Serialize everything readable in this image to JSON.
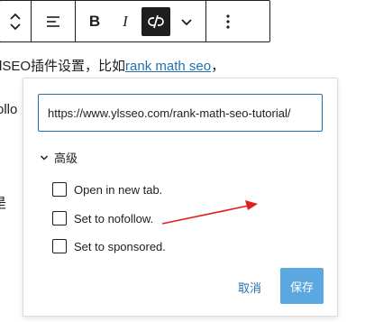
{
  "toolbar": {
    "items": [
      {
        "name": "move-up-down-icon"
      },
      {
        "name": "align-left-icon"
      },
      {
        "name": "bold-icon",
        "label": "B"
      },
      {
        "name": "italic-icon",
        "label": "I"
      },
      {
        "name": "unlink-icon"
      },
      {
        "name": "chevron-down-icon",
        "label": "⌄"
      },
      {
        "name": "more-options-icon",
        "label": "⋮"
      }
    ]
  },
  "background": {
    "line1_text": "lSEO插件设置，比如",
    "line1_link": "rank math seo",
    "line1_after": "，",
    "line2_text": "ollo",
    "line3_text": "是"
  },
  "link_popover": {
    "url_value": "https://www.ylsseo.com/rank-math-seo-tutorial/",
    "advanced_label": "高级",
    "options": [
      {
        "label": "Open in new tab.",
        "checked": false
      },
      {
        "label": "Set to nofollow.",
        "checked": false
      },
      {
        "label": "Set to sponsored.",
        "checked": false
      }
    ],
    "cancel_label": "取消",
    "save_label": "保存"
  },
  "colors": {
    "accent": "#2271b1",
    "save_disabled": "#5ba7e0",
    "annotation_arrow": "#e02020"
  }
}
